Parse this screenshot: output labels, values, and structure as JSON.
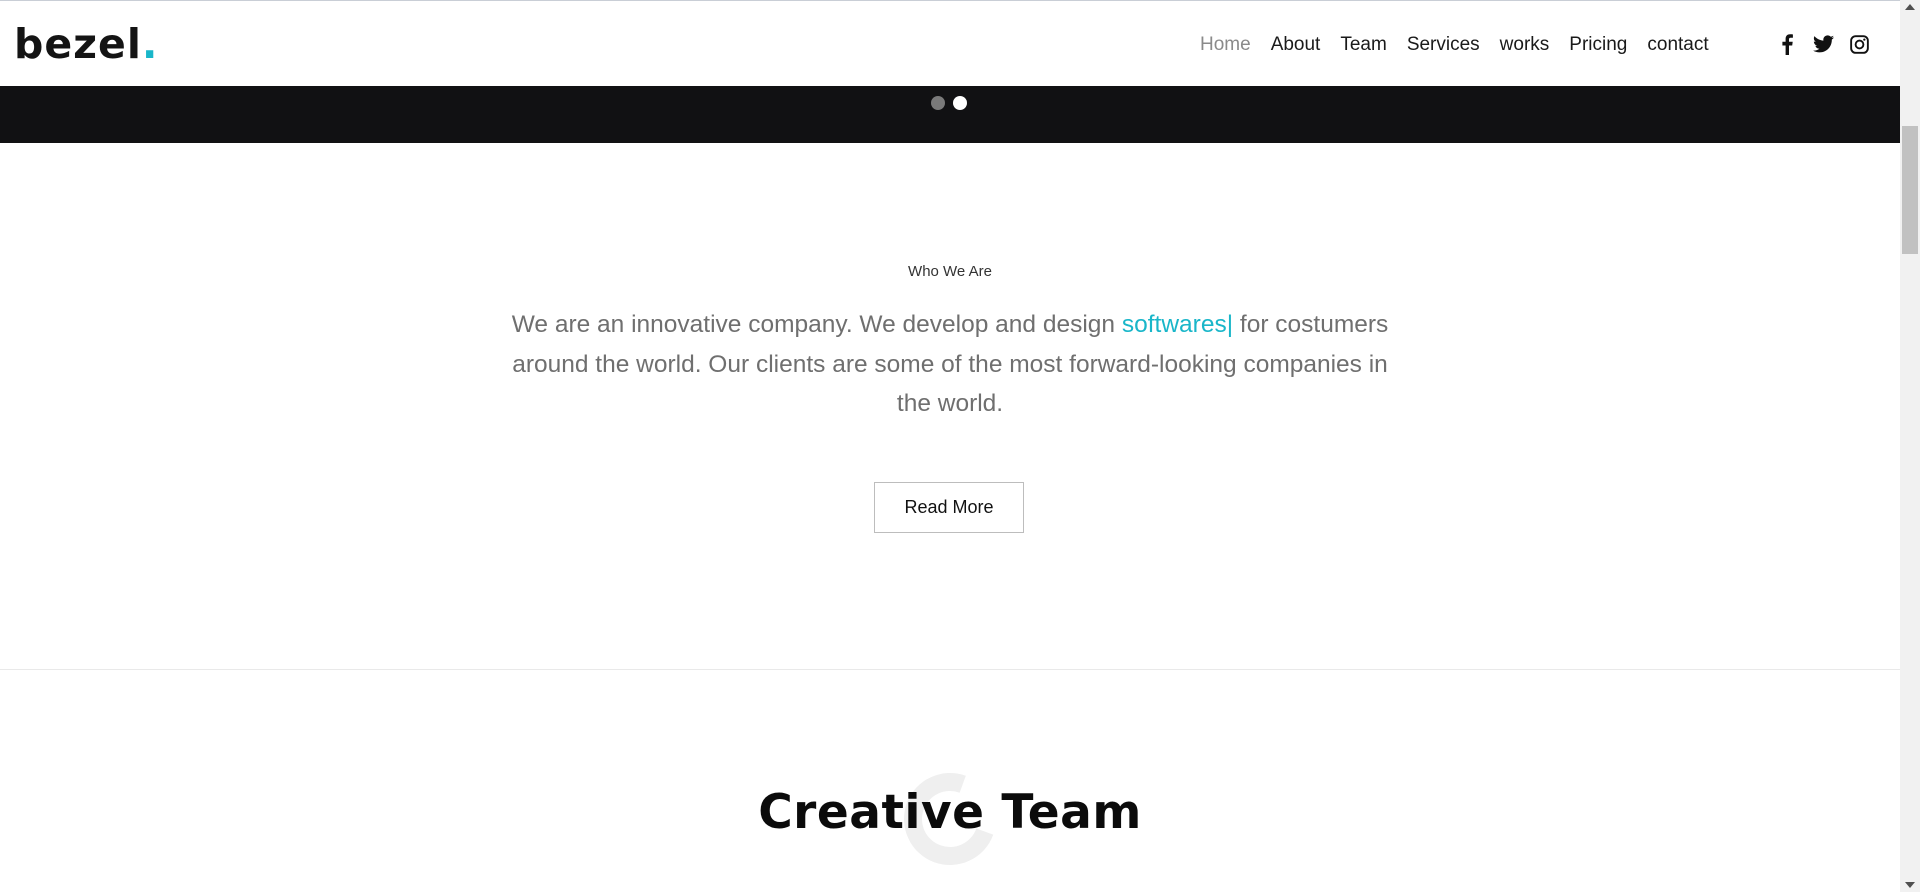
{
  "brand": {
    "name": "bezel",
    "dot": ".",
    "accent_color": "#19b6c9"
  },
  "nav": {
    "items": [
      {
        "label": "Home",
        "active": true
      },
      {
        "label": "About"
      },
      {
        "label": "Team"
      },
      {
        "label": "Services"
      },
      {
        "label": "works"
      },
      {
        "label": "Pricing"
      },
      {
        "label": "contact"
      }
    ]
  },
  "social": {
    "icons": [
      "facebook-icon",
      "twitter-icon",
      "instagram-icon"
    ]
  },
  "slider": {
    "dot_count": 2,
    "active_index": 1
  },
  "about": {
    "label": "Who We Are",
    "text_before": "We are an innovative company. We develop and design ",
    "highlight": "softwares",
    "caret": "|",
    "text_after": " for costumers around the world. Our clients are some of the most forward-looking companies in the world.",
    "button_label": "Read More"
  },
  "team": {
    "title": "Creative Team"
  }
}
